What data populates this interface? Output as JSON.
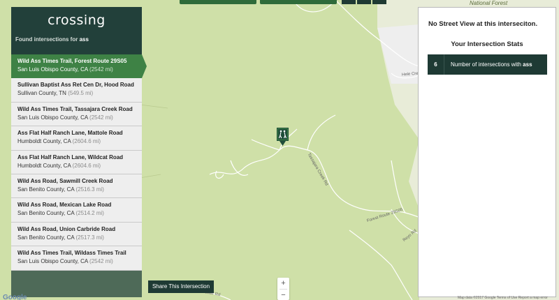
{
  "sidebar": {
    "logo": "crossing",
    "found_prefix": "Found intersections for",
    "query": "ass",
    "results": [
      {
        "title": "Wild Ass Times Trail, Forest Route 29S05",
        "location": "San Luis Obispo County, CA",
        "distance": "(2542 mi)"
      },
      {
        "title": "Sullivan Baptist Ass Ret Cen Dr, Hood Road",
        "location": "Sullivan County, TN",
        "distance": "(549.5 mi)"
      },
      {
        "title": "Wild Ass Times Trail, Tassajara Creek Road",
        "location": "San Luis Obispo County, CA",
        "distance": "(2542 mi)"
      },
      {
        "title": "Ass Flat Half Ranch Lane, Mattole Road",
        "location": "Humboldt County, CA",
        "distance": "(2604.6 mi)"
      },
      {
        "title": "Ass Flat Half Ranch Lane, Wildcat Road",
        "location": "Humboldt County, CA",
        "distance": "(2604.6 mi)"
      },
      {
        "title": "Wild Ass Road, Sawmill Creek Road",
        "location": "San Benito County, CA",
        "distance": "(2516.3 mi)"
      },
      {
        "title": "Wild Ass Road, Mexican Lake Road",
        "location": "San Benito County, CA",
        "distance": "(2514.2 mi)"
      },
      {
        "title": "Wild Ass Road, Union Carbride Road",
        "location": "San Benito County, CA",
        "distance": "(2517.3 mi)"
      },
      {
        "title": "Wild Ass Times Trail, Wildass Times Trail",
        "location": "San Luis Obispo County, CA",
        "distance": "(2542 mi)"
      }
    ]
  },
  "map": {
    "share_label": "Share This Intersection",
    "zoom_in": "+",
    "zoom_out": "−",
    "forest_label": "National Forest",
    "road_tassajara": "Tassajara Creek Rd",
    "road_forest": "Forest Route 29S05",
    "road_hele": "Hele Creek Rd",
    "road_tower": "Tower Rd",
    "road_reyo": "Reyo Rd",
    "google": "Google",
    "footer": "Map data ©2017 Google   Terms of Use   Report a map error"
  },
  "panel": {
    "no_street_view": "No Street View at this interseciton.",
    "stats_title": "Your Intersection Stats",
    "count": "6",
    "count_label_prefix": "Number of intersections with",
    "count_label_query": "ass"
  },
  "colors": {
    "dark_green": "#22403a",
    "active_green": "#3e8245",
    "map_green": "#cfe0a8"
  }
}
